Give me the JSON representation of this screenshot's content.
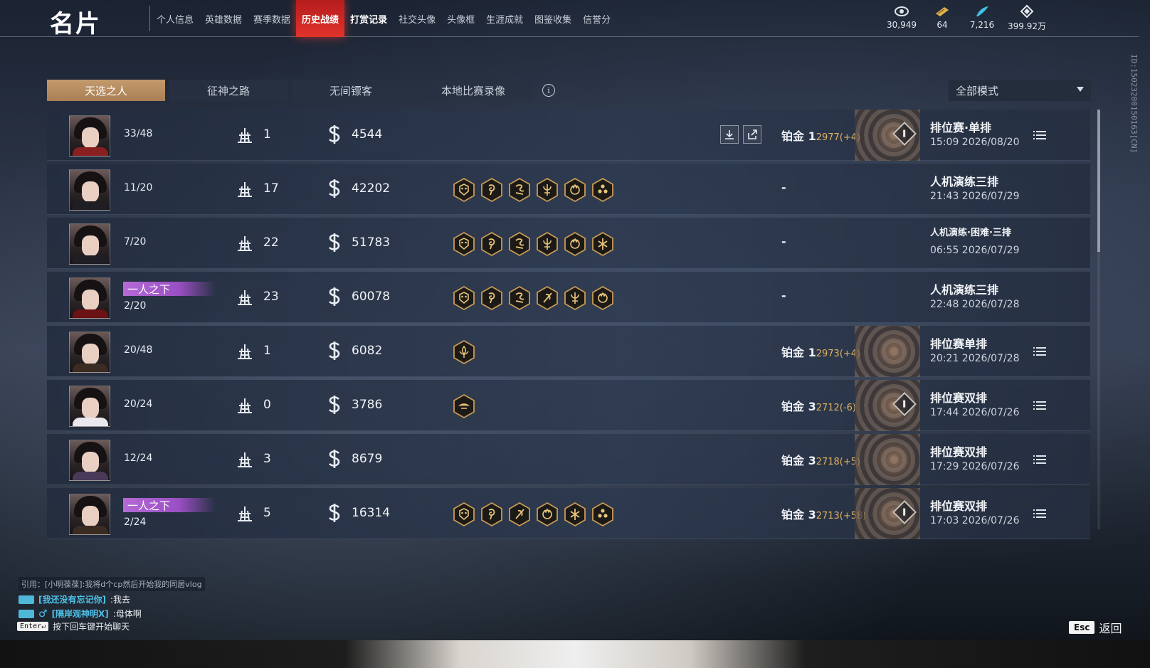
{
  "header": {
    "title": "名片",
    "nav": [
      {
        "label": "个人信息",
        "state": "normal"
      },
      {
        "label": "英雄数据",
        "state": "normal"
      },
      {
        "label": "赛季数据",
        "state": "normal"
      },
      {
        "label": "历史战绩",
        "state": "active"
      },
      {
        "label": "打赏记录",
        "state": "bold"
      },
      {
        "label": "社交头像",
        "state": "normal"
      },
      {
        "label": "头像框",
        "state": "normal"
      },
      {
        "label": "生涯成就",
        "state": "normal"
      },
      {
        "label": "图鉴收集",
        "state": "normal"
      },
      {
        "label": "信誉分",
        "state": "normal"
      }
    ],
    "currencies": [
      {
        "icon": "eye-coin-icon",
        "value": "30,949"
      },
      {
        "icon": "gold-ticket-icon",
        "value": "64"
      },
      {
        "icon": "feather-icon",
        "value": "7,216"
      },
      {
        "icon": "diamond-icon",
        "value": "399.92万"
      }
    ]
  },
  "tabs": [
    {
      "label": "天选之人",
      "active": true
    },
    {
      "label": "征神之路",
      "active": false
    },
    {
      "label": "无间镖客",
      "active": false
    },
    {
      "label": "本地比赛录像",
      "active": false
    }
  ],
  "mode_filter": {
    "selected": "全部模式"
  },
  "player_id": "ID:15023200150163[CN]",
  "matches": [
    {
      "placement": "33/48",
      "tag": "",
      "kills": "1",
      "score": "4544",
      "badges": [],
      "rank": "铂金 1",
      "rank_points": "2977(+4)",
      "has_emblem": true,
      "mode": "排位赛·单排",
      "time": "15:09  2026/08/20",
      "downloadable": true,
      "robe": "#8a1f22"
    },
    {
      "placement": "11/20",
      "tag": "",
      "kills": "17",
      "score": "42202",
      "badges": [
        "demon-badge-icon",
        "swirl-badge-icon",
        "dragon-badge-icon",
        "sigil-badge-icon",
        "crown-badge-icon",
        "triad-badge-icon"
      ],
      "rank": "-",
      "rank_points": "",
      "has_emblem": false,
      "mode": "人机演练三排",
      "time": "21:43  2026/07/29",
      "downloadable": false,
      "robe": "#1e1e24"
    },
    {
      "placement": "7/20",
      "tag": "",
      "kills": "22",
      "score": "51783",
      "badges": [
        "demon-badge-icon",
        "swirl-badge-icon",
        "dragon-badge-icon",
        "sigil-badge-icon",
        "crown-badge-icon",
        "star-badge-icon"
      ],
      "rank": "-",
      "rank_points": "",
      "has_emblem": false,
      "mode": "人机演练·困难·三排",
      "time": "06:55  2026/07/29",
      "downloadable": false,
      "robe": "#1e1e24"
    },
    {
      "placement": "2/20",
      "tag": "一人之下",
      "kills": "23",
      "score": "60078",
      "badges": [
        "demon-badge-icon",
        "swirl-badge-icon",
        "dragon-badge-icon",
        "blade-badge-icon",
        "sigil-badge-icon",
        "crown-badge-icon"
      ],
      "rank": "-",
      "rank_points": "",
      "has_emblem": false,
      "mode": "人机演练三排",
      "time": "22:48  2026/07/28",
      "downloadable": false,
      "robe": "#6a1216"
    },
    {
      "placement": "20/48",
      "tag": "",
      "kills": "1",
      "score": "6082",
      "badges": [
        "lotus-badge-icon"
      ],
      "rank": "铂金 1",
      "rank_points": "2973(+4)",
      "has_emblem": true,
      "mode": "排位赛单排",
      "time": "20:21  2026/07/28",
      "downloadable": false,
      "robe": "#3a2c22"
    },
    {
      "placement": "20/24",
      "tag": "",
      "kills": "0",
      "score": "3786",
      "badges": [
        "wing-badge-icon"
      ],
      "rank": "铂金 3",
      "rank_points": "2712(-6)",
      "has_emblem": true,
      "mode": "排位赛双排",
      "time": "17:44  2026/07/26",
      "downloadable": false,
      "robe": "#e8e8ee"
    },
    {
      "placement": "12/24",
      "tag": "",
      "kills": "3",
      "score": "8679",
      "badges": [],
      "rank": "铂金 3",
      "rank_points": "2718(+5)",
      "has_emblem": true,
      "mode": "排位赛双排",
      "time": "17:29  2026/07/26",
      "downloadable": false,
      "robe": "#4a3a5a"
    },
    {
      "placement": "2/24",
      "tag": "一人之下",
      "kills": "5",
      "score": "16314",
      "badges": [
        "demon-badge-icon",
        "swirl-badge-icon",
        "blade-badge-icon",
        "crown-badge-icon",
        "star-badge-icon",
        "triad-badge-icon"
      ],
      "rank": "铂金 3",
      "rank_points": "2713(+58)",
      "has_emblem": true,
      "mode": "排位赛双排",
      "time": "17:03  2026/07/26",
      "downloadable": false,
      "robe": "#3a2c22"
    }
  ],
  "chat": {
    "quote": "引用：[小明葆葆]:我将d个cp然后开始我的同居vlog",
    "lines": [
      {
        "name": "[我还没有忘记你]",
        "message": ":我去",
        "male": false
      },
      {
        "name": "[隔岸观神明X]",
        "message": ":母体啊",
        "male": true
      }
    ],
    "hint_key": "Enter↵",
    "hint": "按下回车键开始聊天"
  },
  "footer": {
    "esc_key": "Esc",
    "back_label": "返回"
  }
}
